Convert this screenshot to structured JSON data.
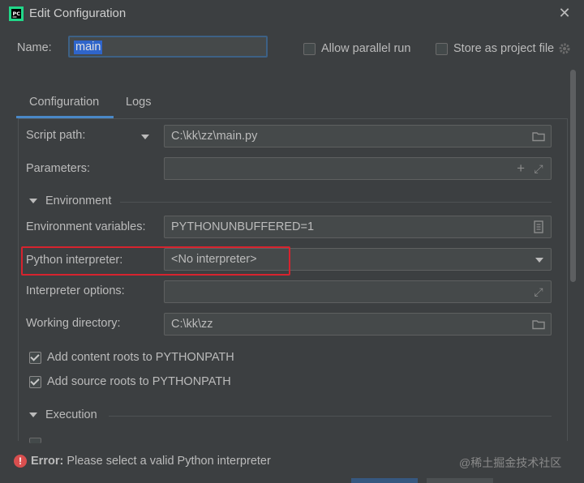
{
  "window": {
    "title": "Edit Configuration"
  },
  "header": {
    "name_label": "Name:",
    "name_value": "main",
    "allow_parallel_label": "Allow parallel run",
    "store_project_label": "Store as project file"
  },
  "tabs": [
    {
      "label": "Configuration",
      "active": true
    },
    {
      "label": "Logs",
      "active": false
    }
  ],
  "form": {
    "script_path_label": "Script path:",
    "script_path_value": "C:\\kk\\zz\\main.py",
    "parameters_label": "Parameters:",
    "environment_section": "Environment",
    "env_vars_label": "Environment variables:",
    "env_vars_value": "PYTHONUNBUFFERED=1",
    "python_interpreter_label": "Python interpreter:",
    "python_interpreter_value": "<No interpreter>",
    "interpreter_options_label": "Interpreter options:",
    "working_dir_label": "Working directory:",
    "working_dir_value": "C:\\kk\\zz",
    "add_content_roots_label": "Add content roots to PYTHONPATH",
    "add_source_roots_label": "Add source roots to PYTHONPATH",
    "execution_section": "Execution"
  },
  "status": {
    "error_prefix": "Error:",
    "error_message": "Please select a valid Python interpreter",
    "watermark": "@稀土掘金技术社区"
  },
  "colors": {
    "background": "#3c3f41",
    "field_bg": "#45494a",
    "accent": "#4a88c7",
    "highlight": "#d7232e",
    "error": "#d94f4f"
  }
}
